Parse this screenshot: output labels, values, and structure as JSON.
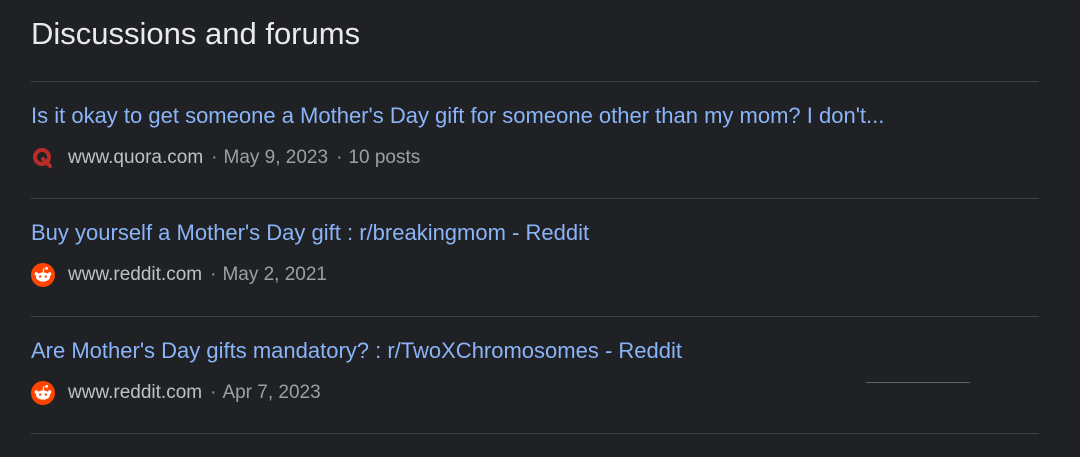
{
  "section": {
    "title": "Discussions and forums"
  },
  "results": [
    {
      "title": "Is it okay to get someone a Mother's Day gift for someone other than my mom? I don't...",
      "site": "www.quora.com",
      "date": "May 9, 2023",
      "posts": "10 posts",
      "icon": "quora-icon"
    },
    {
      "title": "Buy yourself a Mother's Day gift : r/breakingmom - Reddit",
      "site": "www.reddit.com",
      "date": "May 2, 2021",
      "icon": "reddit-icon"
    },
    {
      "title": "Are Mother's Day gifts mandatory? : r/TwoXChromosomes - Reddit",
      "site": "www.reddit.com",
      "date": "Apr 7, 2023",
      "icon": "reddit-icon"
    }
  ],
  "separator": "·",
  "colors": {
    "background": "#202124",
    "link": "#8ab4f8",
    "meta": "#9aa0a6",
    "divider": "#3c4043",
    "quora": "#b92b27",
    "reddit": "#ff4500"
  }
}
